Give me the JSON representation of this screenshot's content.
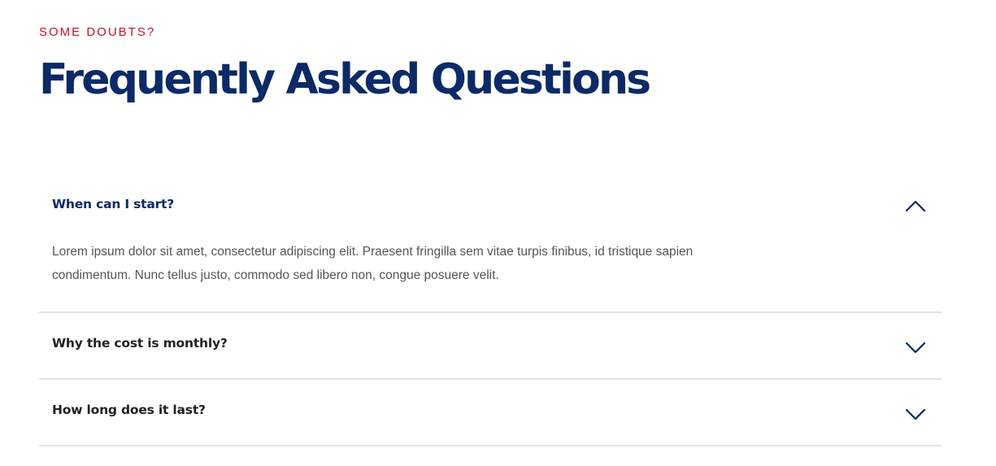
{
  "header": {
    "eyebrow": "SOME DOUBTS?",
    "title": "Frequently Asked Questions"
  },
  "faq": {
    "items": [
      {
        "question": "When can I start?",
        "expanded": true,
        "answer": "Lorem ipsum dolor sit amet, consectetur adipiscing elit. Praesent fringilla sem vitae turpis finibus, id tristique sapien condimentum. Nunc tellus justo, commodo sed libero non, congue posuere velit.",
        "toggle_icon": "chevron-up-icon"
      },
      {
        "question": "Why the cost is monthly?",
        "expanded": false,
        "toggle_icon": "chevron-down-icon"
      },
      {
        "question": "How long does it last?",
        "expanded": false,
        "toggle_icon": "chevron-down-icon"
      }
    ]
  },
  "colors": {
    "accent_red": "#c8102e",
    "navy": "#0b2a66",
    "question_dark": "#222222",
    "body_text": "#555555",
    "divider": "#e3e3e3"
  }
}
